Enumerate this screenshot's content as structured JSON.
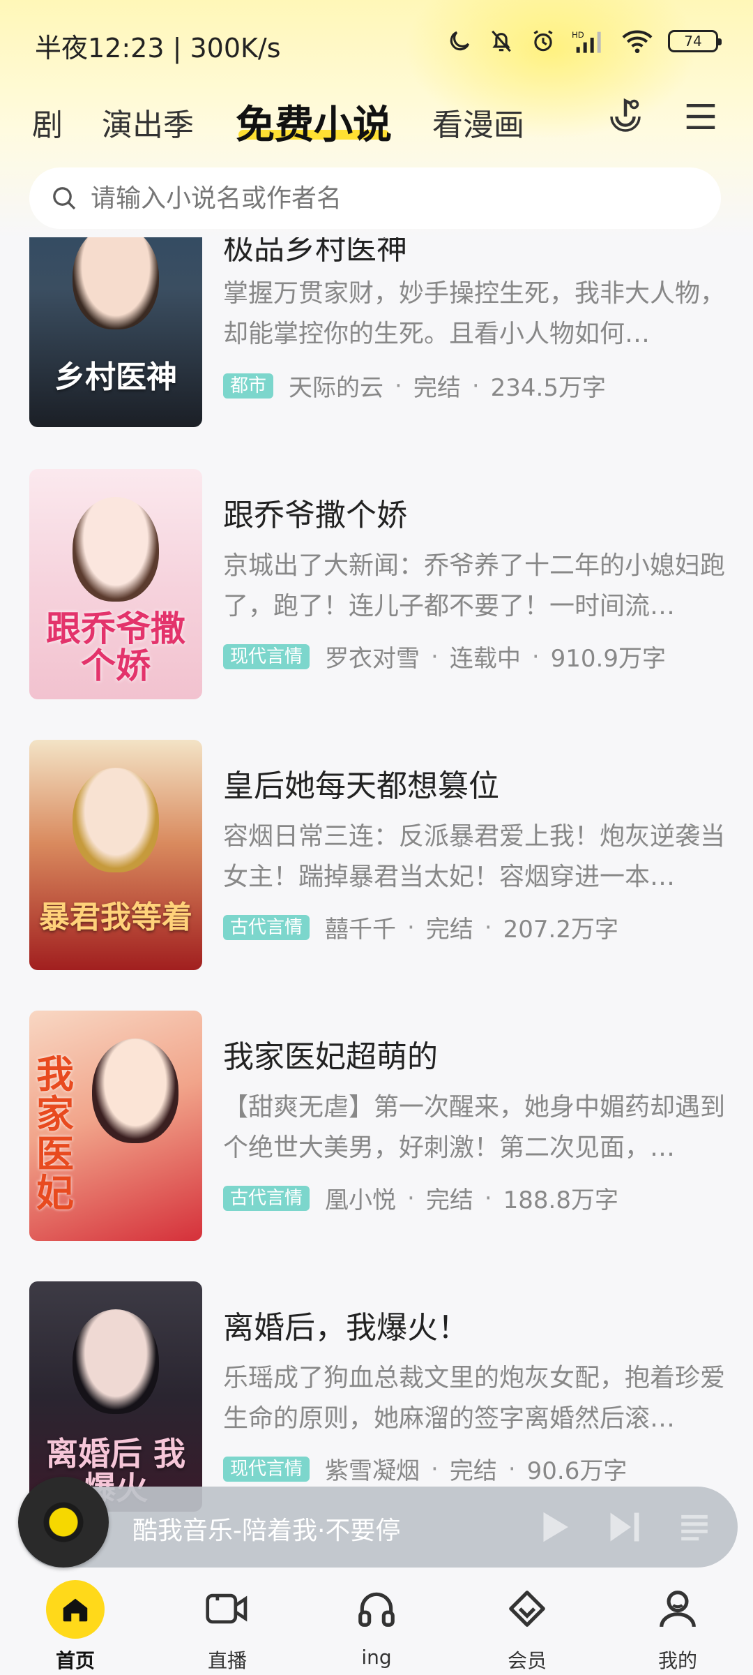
{
  "status_bar": {
    "time": "半夜12:23 | 300K/s",
    "battery": "74"
  },
  "tabs": [
    {
      "label": "剧"
    },
    {
      "label": "演出季"
    },
    {
      "label": "免费小说",
      "active": true
    },
    {
      "label": "看漫画"
    }
  ],
  "search": {
    "placeholder": "请输入小说名或作者名"
  },
  "books": [
    {
      "title": "极品乡村医神",
      "cover_text": "乡村医神",
      "desc": "掌握万贯家财，妙手操控生死，我非大人物，却能掌控你的生死。且看小人物如何…",
      "tag": "都市",
      "author": "天际的云",
      "status": "完结",
      "words": "234.5万字"
    },
    {
      "title": "跟乔爷撒个娇",
      "cover_text": "跟乔爷撒个娇",
      "desc": "京城出了大新闻：乔爷养了十二年的小媳妇跑了，跑了！连儿子都不要了！一时间流…",
      "tag": "现代言情",
      "author": "罗衣对雪",
      "status": "连载中",
      "words": "910.9万字"
    },
    {
      "title": "皇后她每天都想篡位",
      "cover_text": "暴君我等着",
      "desc": "容烟日常三连：反派暴君爱上我！炮灰逆袭当女主！踹掉暴君当太妃！容烟穿进一本…",
      "tag": "古代言情",
      "author": "囍千千",
      "status": "完结",
      "words": "207.2万字"
    },
    {
      "title": "我家医妃超萌的",
      "cover_text": "我家医妃",
      "desc": "【甜爽无虐】第一次醒来，她身中媚药却遇到个绝世大美男，好刺激！第二次见面，…",
      "tag": "古代言情",
      "author": "凰小悦",
      "status": "完结",
      "words": "188.8万字"
    },
    {
      "title": "离婚后，我爆火！",
      "cover_text": "离婚后 我爆火",
      "desc": "乐瑶成了狗血总裁文里的炮灰女配，抱着珍爱生命的原则，她麻溜的签字离婚然后滚…",
      "tag": "现代言情",
      "author": "紫雪凝烟",
      "status": "完结",
      "words": "90.6万字"
    }
  ],
  "player": {
    "text": "酷我音乐-陪着我·不要停"
  },
  "bottom_nav": [
    {
      "label": "首页",
      "icon": "home-icon",
      "active": true
    },
    {
      "label": "直播",
      "icon": "video-icon"
    },
    {
      "label": "ing",
      "icon": "headphones-icon"
    },
    {
      "label": "会员",
      "icon": "diamond-icon"
    },
    {
      "label": "我的",
      "icon": "user-icon"
    }
  ],
  "colors": {
    "accent": "#ffd91a",
    "tag": "#7cd6cc"
  }
}
